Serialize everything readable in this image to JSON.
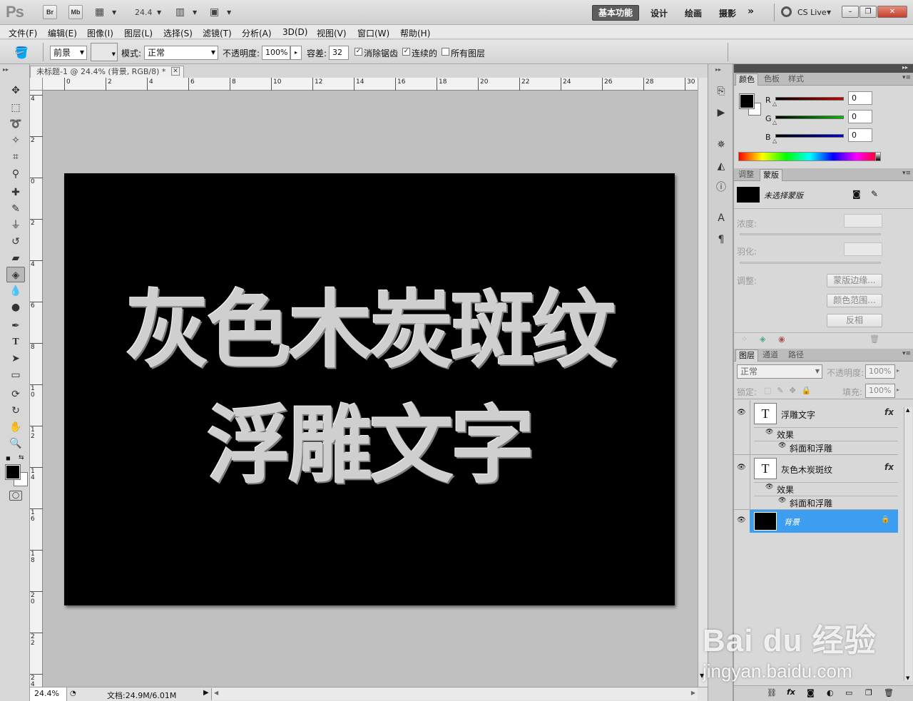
{
  "app": {
    "logo": "Ps",
    "bridge_label": "Br",
    "minibridge_label": "Mb",
    "zoom": "24.4",
    "workspaces": {
      "active": "基本功能",
      "items": [
        "设计",
        "绘画",
        "摄影"
      ]
    },
    "cs_live": "CS Live"
  },
  "menu": [
    "文件(F)",
    "编辑(E)",
    "图像(I)",
    "图层(L)",
    "选择(S)",
    "滤镜(T)",
    "分析(A)",
    "3D(D)",
    "视图(V)",
    "窗口(W)",
    "帮助(H)"
  ],
  "options": {
    "fill_source": "前景",
    "mode_label": "模式:",
    "mode_value": "正常",
    "opacity_label": "不透明度:",
    "opacity_value": "100%",
    "tolerance_label": "容差:",
    "tolerance_value": "32",
    "anti_alias": "消除锯齿",
    "contiguous": "连续的",
    "all_layers": "所有图层"
  },
  "document": {
    "tab_title": "未标题-1 @ 24.4% (背景, RGB/8) *",
    "hruler_labels": [
      "0",
      "2",
      "4",
      "6",
      "8",
      "10",
      "12",
      "14",
      "16",
      "18",
      "20",
      "22",
      "24",
      "26",
      "28",
      "30"
    ],
    "vruler_labels": [
      "4",
      "2",
      "0",
      "2",
      "4",
      "6",
      "8",
      "10",
      "12",
      "14",
      "16",
      "18",
      "20",
      "22",
      "24"
    ],
    "canvas_line1": "灰色木炭斑纹",
    "canvas_line2": "浮雕文字",
    "status_zoom": "24.4%",
    "status_doc": "文档:24.9M/6.01M"
  },
  "color_panel": {
    "tabs": [
      "颜色",
      "色板",
      "样式"
    ],
    "channels": [
      {
        "label": "R",
        "value": "0",
        "color": "#d00000"
      },
      {
        "label": "G",
        "value": "0",
        "color": "#00c000"
      },
      {
        "label": "B",
        "value": "0",
        "color": "#0000d0"
      }
    ]
  },
  "masks_panel": {
    "tabs": [
      "调整",
      "蒙版"
    ],
    "no_mask": "未选择蒙版",
    "density": "浓度:",
    "feather": "羽化:",
    "refine": "调整:",
    "mask_edge": "蒙版边缘...",
    "color_range": "颜色范围...",
    "invert": "反相"
  },
  "layers_panel": {
    "tabs": [
      "图层",
      "通道",
      "路径"
    ],
    "blend_mode": "正常",
    "opacity_label": "不透明度:",
    "opacity_value": "100%",
    "lock_label": "锁定:",
    "fill_label": "填充:",
    "fill_value": "100%",
    "layers": [
      {
        "name": "浮雕文字",
        "thumb": "T",
        "effects_label": "效果",
        "effect": "斜面和浮雕"
      },
      {
        "name": "灰色木炭斑纹",
        "thumb": "T",
        "effects_label": "效果",
        "effect": "斜面和浮雕"
      },
      {
        "name": "背景",
        "selected": true
      }
    ]
  },
  "watermark": {
    "brand": "Bai du 经验",
    "url": "jingyan.baidu.com"
  }
}
